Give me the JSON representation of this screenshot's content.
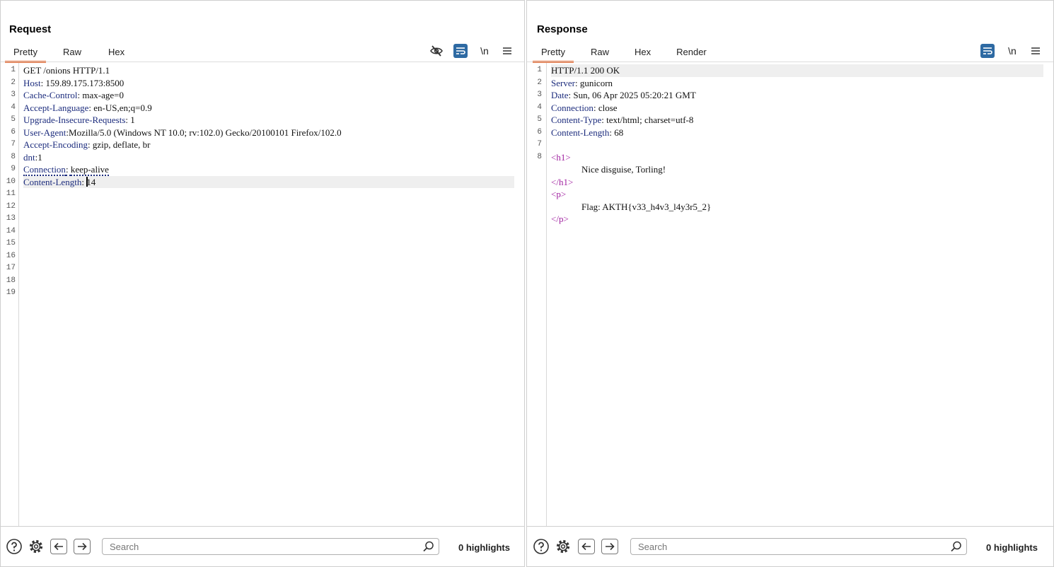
{
  "request": {
    "title": "Request",
    "tabs": [
      "Pretty",
      "Raw",
      "Hex"
    ],
    "active_tab": "Pretty",
    "toolbar": {
      "newline_label": "\\n"
    },
    "lines": [
      {
        "n": "1",
        "key": "",
        "text": "GET /onions HTTP/1.1"
      },
      {
        "n": "2",
        "key": "Host",
        "text": "159.89.175.173:8500"
      },
      {
        "n": "3",
        "key": "Cache-Control",
        "text": "max-age=0"
      },
      {
        "n": "4",
        "key": "Accept-Language",
        "text": "en-US,en;q=0.9"
      },
      {
        "n": "5",
        "key": "Upgrade-Insecure-Requests",
        "text": "1"
      },
      {
        "n": "6",
        "key": "User-Agent",
        "text": "Mozilla/5.0 (Windows NT 10.0; rv:102.0) Gecko/20100101 Firefox/102.0"
      },
      {
        "n": "7",
        "key": "Accept-Encoding",
        "text": "gzip, deflate, br"
      },
      {
        "n": "8",
        "key": "dnt",
        "text": "1"
      },
      {
        "n": "9",
        "key": "Connection",
        "text": "keep-alive"
      },
      {
        "n": "10",
        "key": "Content-Length",
        "text": "14"
      },
      {
        "n": "11",
        "key": "",
        "text": ""
      },
      {
        "n": "12",
        "key": "",
        "text": ""
      },
      {
        "n": "13",
        "key": "",
        "text": ""
      },
      {
        "n": "14",
        "key": "",
        "text": ""
      },
      {
        "n": "15",
        "key": "",
        "text": ""
      },
      {
        "n": "16",
        "key": "",
        "text": ""
      },
      {
        "n": "17",
        "key": "",
        "text": ""
      },
      {
        "n": "18",
        "key": "",
        "text": ""
      },
      {
        "n": "19",
        "key": "",
        "text": ""
      }
    ],
    "footer": {
      "search_placeholder": "Search",
      "highlights": "0 highlights"
    }
  },
  "response": {
    "title": "Response",
    "tabs": [
      "Pretty",
      "Raw",
      "Hex",
      "Render"
    ],
    "active_tab": "Pretty",
    "toolbar": {
      "newline_label": "\\n"
    },
    "header_lines": [
      {
        "n": "1",
        "key": "",
        "text": "HTTP/1.1 200 OK"
      },
      {
        "n": "2",
        "key": "Server",
        "text": "gunicorn"
      },
      {
        "n": "3",
        "key": "Date",
        "text": "Sun, 06 Apr 2025 05:20:21 GMT"
      },
      {
        "n": "4",
        "key": "Connection",
        "text": "close"
      },
      {
        "n": "5",
        "key": "Content-Type",
        "text": "text/html; charset=utf-8"
      },
      {
        "n": "6",
        "key": "Content-Length",
        "text": "68"
      },
      {
        "n": "7",
        "key": "",
        "text": ""
      }
    ],
    "body_line_number": "8",
    "body": {
      "h1_open": "h1",
      "h1_text": "Nice disguise, Torling!",
      "h1_close": "/h1",
      "p_open": "p",
      "p_text": "Flag: AKTH{v33_h4v3_l4y3r5_2}",
      "p_close": "/p"
    },
    "footer": {
      "search_placeholder": "Search",
      "highlights": "0 highlights"
    }
  }
}
